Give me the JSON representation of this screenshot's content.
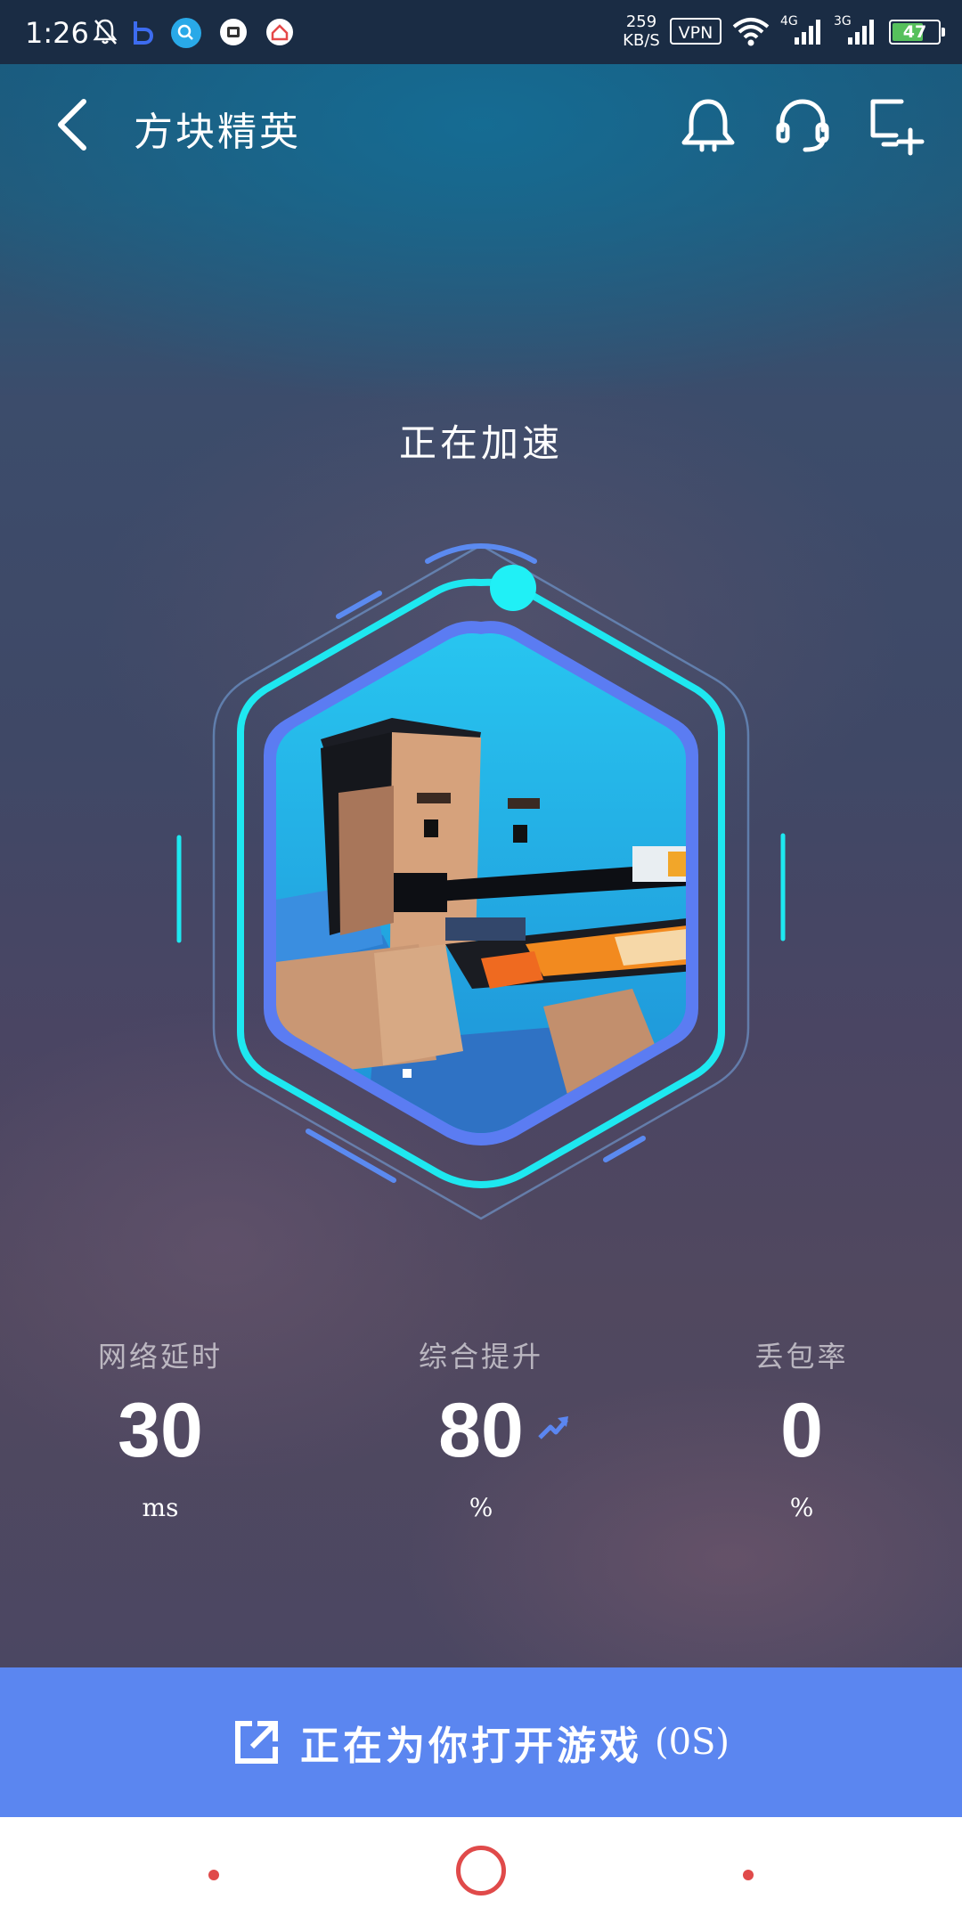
{
  "status_bar": {
    "time": "1:26",
    "net_speed_value": "259",
    "net_speed_unit": "KB/S",
    "vpn": "VPN",
    "signal_1_label": "4G",
    "signal_2_label": "3G",
    "battery": "47",
    "battery_color": "#56c05c"
  },
  "header": {
    "title": "方块精英",
    "icons": [
      "back-arrow-icon",
      "bell-icon",
      "headset-icon",
      "add-shortcut-icon"
    ]
  },
  "boost": {
    "status": "正在加速",
    "game_icon": "blocky-sniper-game-icon",
    "ring_accent": "#1ee8f0",
    "ring_inner": "#5b7cf2"
  },
  "stats": [
    {
      "label": "网络延时",
      "value": "30",
      "unit": "ms"
    },
    {
      "label": "综合提升",
      "value": "80",
      "unit": "%",
      "trend": "up-trend-icon"
    },
    {
      "label": "丢包率",
      "value": "0",
      "unit": "%"
    }
  ],
  "open_button": {
    "label": "正在为你打开游戏",
    "countdown": "(0S)",
    "color": "#5b86f0"
  },
  "nav_bar": {
    "accent": "#e04a4a"
  }
}
